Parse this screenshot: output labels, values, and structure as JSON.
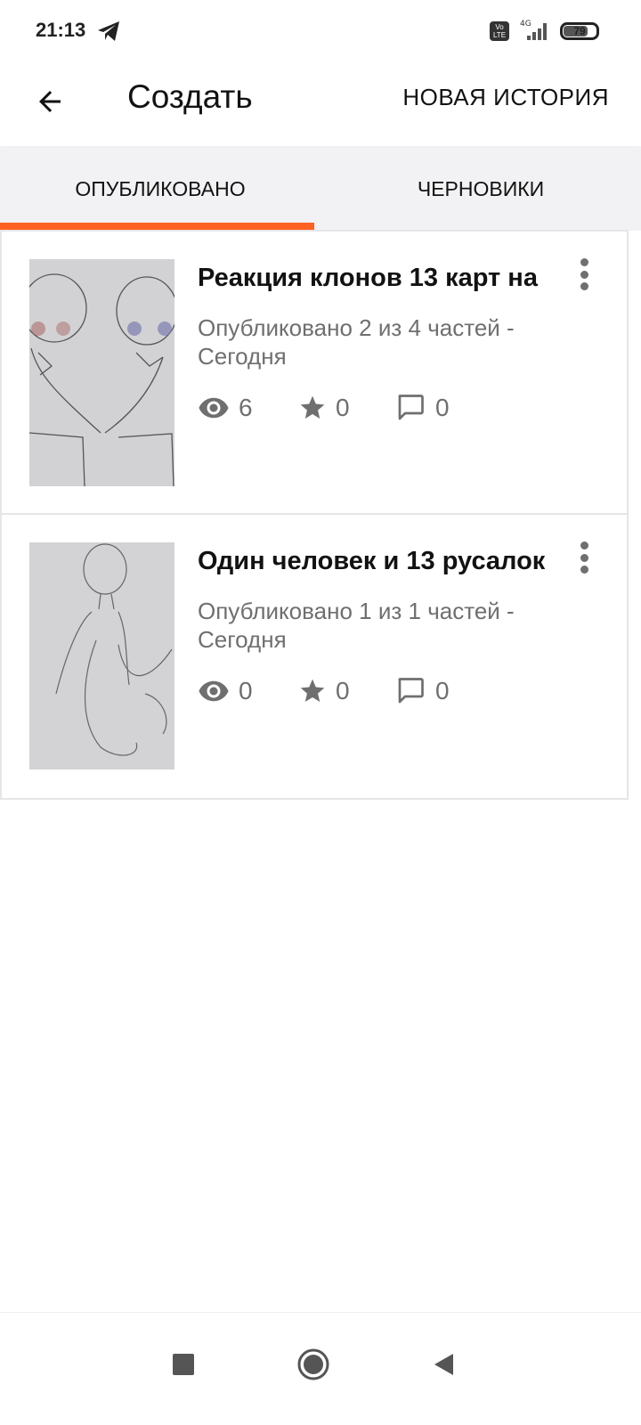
{
  "status_bar": {
    "time": "21:13",
    "network": "4G",
    "volte": "Vo\nLTE",
    "battery": "79",
    "battery_level_percent": 79,
    "icons": [
      "telegram-icon",
      "volte-icon",
      "signal-icon",
      "battery-icon"
    ]
  },
  "app_bar": {
    "title": "Создать",
    "action_label": "НОВАЯ ИСТОРИЯ",
    "back_icon": "arrow-left-icon"
  },
  "tabs": [
    {
      "label": "ОПУБЛИКОВАНО",
      "selected": true
    },
    {
      "label": "ЧЕРНОВИКИ",
      "selected": false
    }
  ],
  "stories": [
    {
      "title": "Реакция клонов 13 карт на",
      "meta": "Опубликовано 2 из 4 частей - Сегодня",
      "views": "6",
      "votes": "0",
      "comments": "0",
      "cover": "sketch-two-figures-holding-hands"
    },
    {
      "title": "Один человек и 13 русалок",
      "meta": "Опубликовано 1 из 1 частей - Сегодня",
      "views": "0",
      "votes": "0",
      "comments": "0",
      "cover": "sketch-mermaid"
    }
  ],
  "nav_bar": {
    "icons": [
      "recents-square-icon",
      "home-circle-icon",
      "back-triangle-icon"
    ]
  },
  "colors": {
    "accent": "#ff6122",
    "text_primary": "#121212",
    "text_secondary": "#6f6f6f",
    "tabs_background": "#f2f2f4"
  }
}
